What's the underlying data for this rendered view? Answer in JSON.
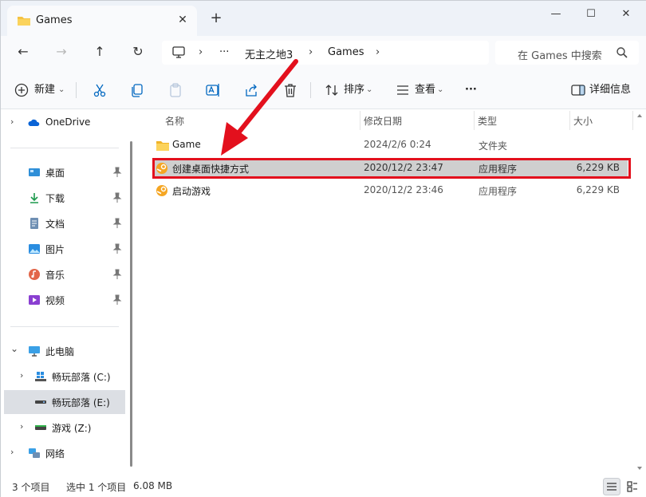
{
  "tab": {
    "title": "Games",
    "close": "✕",
    "new_tab": "+"
  },
  "window_controls": {
    "minimize": "—",
    "maximize": "☐",
    "close": "✕"
  },
  "nav": {
    "back": "←",
    "forward": "→",
    "up": "↑",
    "refresh": "↻",
    "breadcrumb": [
      "无主之地3",
      "Games"
    ],
    "ellipsis": "···",
    "separator": "›",
    "search_placeholder": "在 Games 中搜索"
  },
  "toolbar": {
    "new_label": "新建",
    "sort_label": "排序",
    "view_label": "查看",
    "more": "···",
    "details_label": "详细信息"
  },
  "sidebar": {
    "onedrive": "OneDrive",
    "quick": [
      {
        "label": "桌面",
        "icon": "desktop-icon"
      },
      {
        "label": "下载",
        "icon": "download-icon"
      },
      {
        "label": "文档",
        "icon": "document-icon"
      },
      {
        "label": "图片",
        "icon": "pictures-icon"
      },
      {
        "label": "音乐",
        "icon": "music-icon"
      },
      {
        "label": "视频",
        "icon": "video-icon"
      }
    ],
    "this_pc": "此电脑",
    "drives": [
      {
        "label": "畅玩部落 (C:)"
      },
      {
        "label": "畅玩部落 (E:)"
      },
      {
        "label": "游戏 (Z:)"
      }
    ],
    "network": "网络"
  },
  "columns": {
    "name": "名称",
    "date": "修改日期",
    "type": "类型",
    "size": "大小"
  },
  "files": [
    {
      "name": "Game",
      "date": "2024/2/6 0:24",
      "type": "文件夹",
      "size": "",
      "icon": "folder-icon"
    },
    {
      "name": "创建桌面快捷方式",
      "date": "2020/12/2 23:47",
      "type": "应用程序",
      "size": "6,229 KB",
      "icon": "app-icon"
    },
    {
      "name": "启动游戏",
      "date": "2020/12/2 23:46",
      "type": "应用程序",
      "size": "6,229 KB",
      "icon": "app-icon"
    }
  ],
  "status": {
    "count": "3 个项目",
    "selected": "选中 1 个项目",
    "size": "6.08 MB"
  },
  "colors": {
    "accent": "#0067c0",
    "highlight_box": "#e3101d",
    "arrow": "#e3101d",
    "selected_row": "#cfcfcf"
  }
}
